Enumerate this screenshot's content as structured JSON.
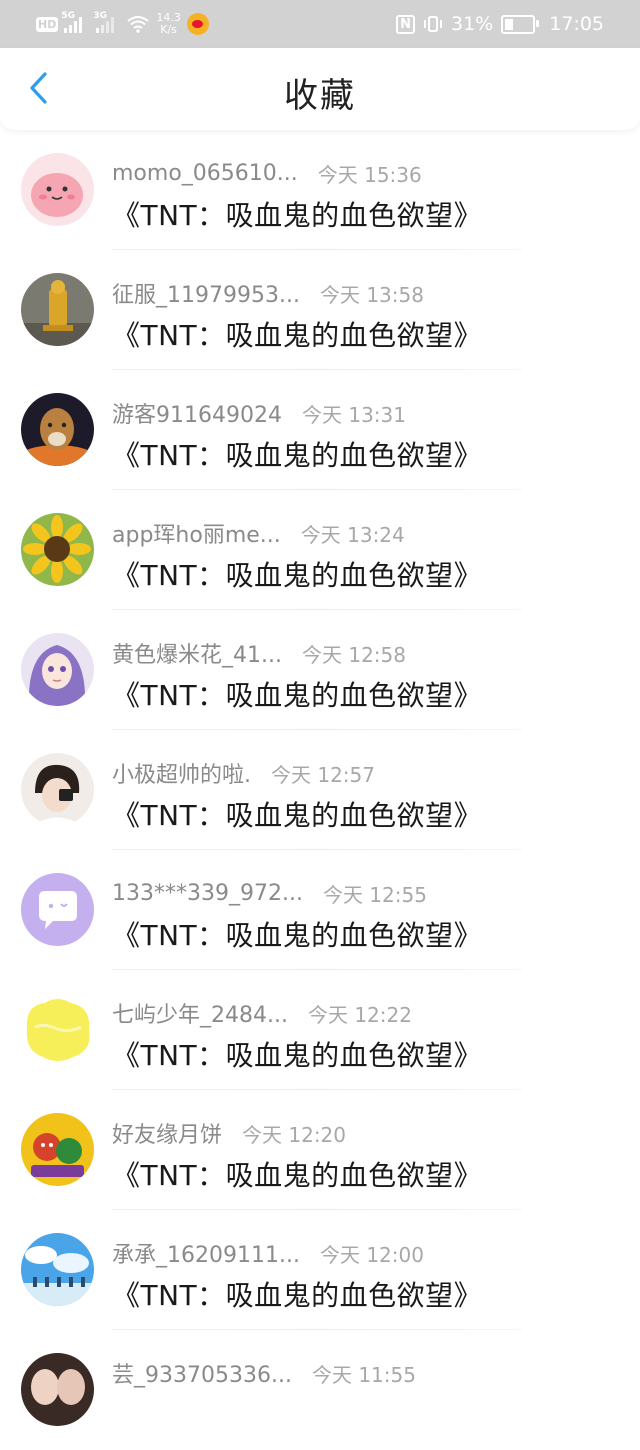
{
  "status_bar": {
    "network_gen_1": "5G",
    "network_gen_2": "3G",
    "speed_value": "14.3",
    "speed_unit": "K/s",
    "nfc": "N",
    "battery_percent": "31%",
    "time": "17:05",
    "icons": [
      "hd-badge-icon",
      "signal-icon",
      "wifi-icon",
      "weibo-icon",
      "nfc-icon",
      "vibrate-icon",
      "battery-icon"
    ]
  },
  "header": {
    "title": "收藏",
    "back_icon": "chevron-left-icon",
    "accent_color": "#2b9cf0"
  },
  "items": [
    {
      "name": "momo_065610...",
      "time": "今天 15:36",
      "content": "《TNT：吸血鬼的血色欲望》",
      "avatar": "pink-cartoon"
    },
    {
      "name": "征服_11979953...",
      "time": "今天 13:58",
      "content": "《TNT：吸血鬼的血色欲望》",
      "avatar": "gold-statue"
    },
    {
      "name": "游客911649024",
      "time": "今天 13:31",
      "content": "《TNT：吸血鬼的血色欲望》",
      "avatar": "cougar"
    },
    {
      "name": "app珲ho丽me...",
      "time": "今天 13:24",
      "content": "《TNT：吸血鬼的血色欲望》",
      "avatar": "sunflower"
    },
    {
      "name": "黄色爆米花_41...",
      "time": "今天 12:58",
      "content": "《TNT：吸血鬼的血色欲望》",
      "avatar": "anime-girl"
    },
    {
      "name": "小极超帅的啦.",
      "time": "今天 12:57",
      "content": "《TNT：吸血鬼的血色欲望》",
      "avatar": "girl-photo"
    },
    {
      "name": "133***339_972...",
      "time": "今天 12:55",
      "content": "《TNT：吸血鬼的血色欲望》",
      "avatar": "default-chat"
    },
    {
      "name": "七屿少年_2484...",
      "time": "今天 12:22",
      "content": "《TNT：吸血鬼的血色欲望》",
      "avatar": "yellow-blob"
    },
    {
      "name": "好友缘月饼",
      "time": "今天 12:20",
      "content": "《TNT：吸血鬼的血色欲望》",
      "avatar": "cartoon-yellow"
    },
    {
      "name": "承承_16209111...",
      "time": "今天 12:00",
      "content": "《TNT：吸血鬼的血色欲望》",
      "avatar": "blue-sky"
    },
    {
      "name": "芸_933705336...",
      "time": "今天 11:55",
      "content": "",
      "avatar": "two-people"
    }
  ]
}
